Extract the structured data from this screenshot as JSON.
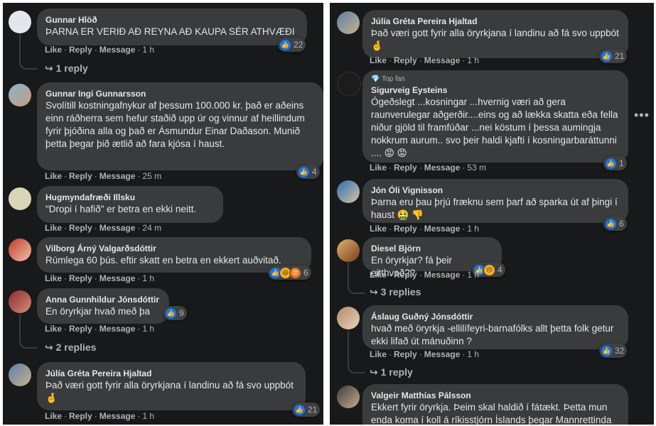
{
  "actions": {
    "like": "Like",
    "reply": "Reply",
    "message": "Message",
    "sep": "·"
  },
  "left": [
    {
      "name": "Gunnar Hlöð",
      "text": "ÞARNA ER VERIÐ AÐ REYNA AÐ KAUPA SÉR ATHVÆÐI",
      "time": "1 h",
      "reactions": "22",
      "replies": "1 reply"
    },
    {
      "name": "Gunnar Ingi Gunnarsson",
      "text": "Svolítill kostningafnykur af þessum 100.000 kr. það er aðeins einn ráðherra sem hefur staðið upp úr og vinnur af heillindum fyrir þjóðina alla og það er Ásmundur Einar Daðason. Munið þetta þegar þið ætlið að fara kjósa í haust.",
      "time": "25 m",
      "reactions": "4"
    },
    {
      "name": "Hugmyndafræði Illsku",
      "text": "\"Dropi í hafið\" er betra en ekki neitt.",
      "time": "24 m"
    },
    {
      "name": "Vilborg Árný Valgarðsdóttir",
      "text": "Rúmlega 60 þús. eftir skatt en betra en ekkert auðvitað.",
      "time": "1 h",
      "reactions": "6"
    },
    {
      "name": "Anna Gunnhildur Jónsdóttir",
      "text": "En öryrkjar hvað með þa",
      "time": "1 h",
      "reactions": "9",
      "replies": "2 replies"
    },
    {
      "name": "Júlía Gréta Pereira Hjaltad",
      "text": "Það væri gott fyrir alla öryrkjana í landinu að fá svo uppbót 🤞",
      "time": "1 h",
      "reactions": "21"
    }
  ],
  "right": [
    {
      "name": "Júlía Gréta Pereira Hjaltad",
      "text": "Það væri gott fyrir alla öryrkjana í landinu að fá svo uppbót 🤞",
      "time": "1 h",
      "reactions": "21"
    },
    {
      "badge": "Top fan",
      "name": "Sigurveig Eysteins",
      "text": "Ógeðslegt ...kosningar ...hvernig væri að gera raunverulegar aðgerðir....eins og að lækka skatta eða fella niður gjöld til framfúðar ...nei köstum í þessa aumingja nokkrum aurum.. svo þeir haldi kjafti í kosningarbaráttunni .... 😡 😡",
      "time": "53 m",
      "reactions": "1"
    },
    {
      "name": "Jón Óli Vignisson",
      "text": "Þarna eru þau þrjú fræknu sem þarf að sparka út af þingi í haust 🤮 👎",
      "time": "1 h",
      "reactions": "6"
    },
    {
      "name": "Diesel Björn",
      "text": "En öryrkjar? fá þeir eitthvað??",
      "time": "1 h",
      "reactions": "4",
      "replies": "3 replies"
    },
    {
      "name": "Áslaug Guðný Jónsdóttir",
      "text": "hvað með öryrkja -ellilífeyri-barnafólks allt þetta folk getur ekki lifað út mánuðinn ?",
      "time": "1 h",
      "reactions": "32",
      "replies": "1 reply"
    },
    {
      "name": "Valgeir Matthías Pálsson",
      "text": "Ekkert fyrir öryrkja. Þeim skal haldið í fátækt. Þetta mun enda koma í koll á ríkisstjórn Íslands þegar Mannrettinda"
    }
  ],
  "icons": {
    "reply_arrow": "↪",
    "more": "•••"
  }
}
